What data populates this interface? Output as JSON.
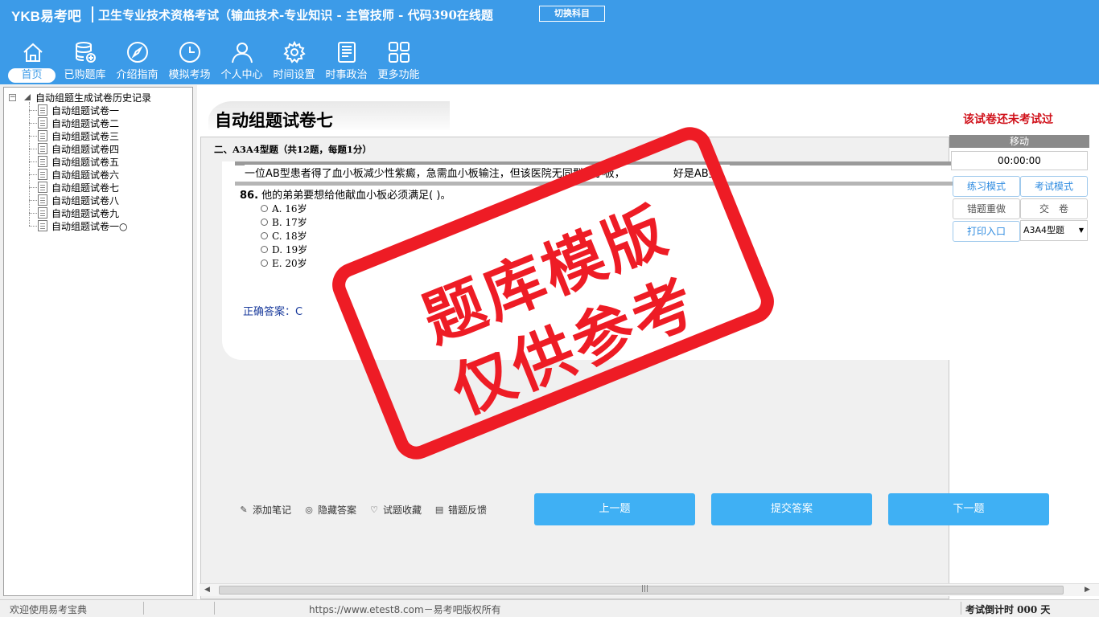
{
  "header": {
    "logo": "YKB易考吧",
    "title": "卫生专业技术资格考试（输血技术-专业知识 - 主管技师 - 代码390在线题",
    "switch_button": "切换科目"
  },
  "nav": [
    {
      "label": "首页",
      "icon": "home-icon"
    },
    {
      "label": "已购题库",
      "icon": "database-icon"
    },
    {
      "label": "介绍指南",
      "icon": "compass-icon"
    },
    {
      "label": "模拟考场",
      "icon": "clock-icon"
    },
    {
      "label": "个人中心",
      "icon": "user-icon"
    },
    {
      "label": "时间设置",
      "icon": "gear-icon"
    },
    {
      "label": "时事政治",
      "icon": "news-icon"
    },
    {
      "label": "更多功能",
      "icon": "grid-icon"
    }
  ],
  "tree": {
    "root": "自动组题生成试卷历史记录",
    "items": [
      "自动组题试卷一",
      "自动组题试卷二",
      "自动组题试卷三",
      "自动组题试卷四",
      "自动组题试卷五",
      "自动组题试卷六",
      "自动组题试卷七",
      "自动组题试卷八",
      "自动组题试卷九",
      "自动组题试卷一○"
    ]
  },
  "paper": {
    "title": "自动组题试卷七",
    "status": "该试卷还未考试过"
  },
  "section": {
    "title": "二、A3A4型题（共12题，每题1分）"
  },
  "question": {
    "stem": "一位AB型患者得了血小板减少性紫癜，急需血小板输注，但该医院无同型血小板，",
    "stem_tail": "好是AB型。",
    "number": "86.",
    "text": "他的弟弟要想给他献血小板必须满足( )。",
    "options": [
      "A. 16岁",
      "B. 17岁",
      "C. 18岁",
      "D. 19岁",
      "E. 20岁"
    ],
    "answer": "正确答案：C"
  },
  "tools": {
    "add_note": "添加笔记",
    "hide_answer": "隐藏答案",
    "favorite": "试题收藏",
    "feedback": "错题反馈"
  },
  "buttons": {
    "prev": "上一题",
    "submit": "提交答案",
    "next": "下一题"
  },
  "panel": {
    "move": "移动",
    "timer": "00:00:00",
    "practice_mode": "练习模式",
    "exam_mode": "考试模式",
    "redo_wrong": "错题重做",
    "hand_in": "交　卷",
    "print": "打印入口",
    "type_select": "A3A4型题"
  },
  "watermark": {
    "line1": "题库模版",
    "line2": "仅供参考"
  },
  "status": {
    "welcome": "欢迎使用易考宝典",
    "copyright": "https://www.etest8.com－易考吧版权所有",
    "countdown": "考试倒计时 000 天"
  },
  "colors": {
    "header_bg": "#3c9be8",
    "button_bg": "#3fb0f4",
    "stamp_red": "#ee1c25",
    "status_red": "#d0121b",
    "answer_blue": "#1a3b9c"
  }
}
